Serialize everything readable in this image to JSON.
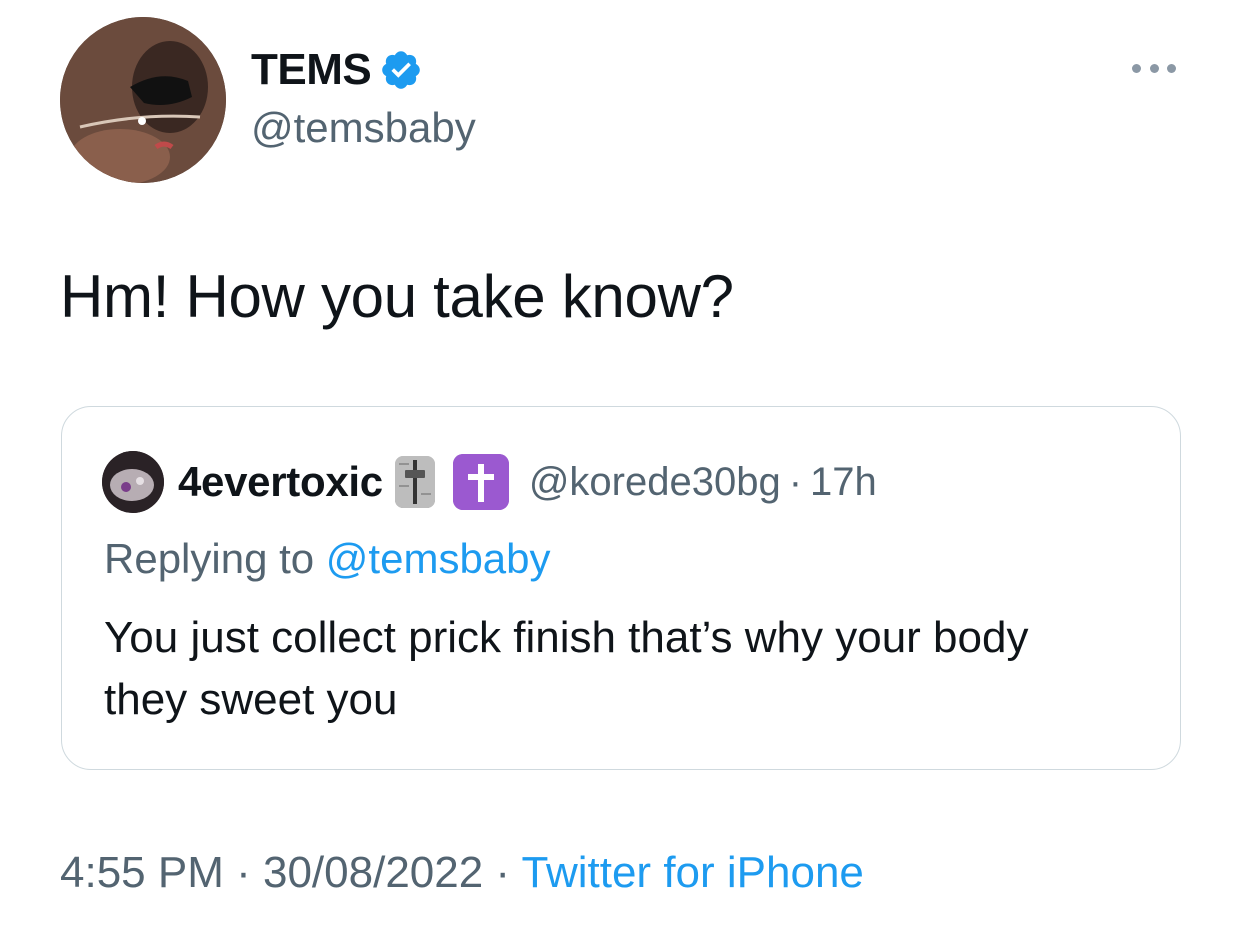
{
  "tweet": {
    "author": {
      "display_name": "TEMS",
      "handle": "@temsbaby",
      "verified_icon": "verified-badge-icon",
      "avatar_icon": "profile-photo"
    },
    "more_icon": "more-options-icon",
    "text": "Hm! How you take know?",
    "quoted": {
      "display_name": "4evertoxic",
      "emojis": [
        "level-slider-emoji",
        "latin-cross-emoji"
      ],
      "handle": "@korede30bg",
      "separator": "·",
      "time": "17h",
      "replying_prefix": "Replying to ",
      "replying_to": "@temsbaby",
      "text": "You just collect prick finish that’s why your body they sweet you"
    },
    "meta": {
      "time": "4:55 PM",
      "separator": " · ",
      "date": "30/08/2022",
      "source": "Twitter for iPhone"
    }
  },
  "colors": {
    "text_primary": "#0f1419",
    "text_secondary": "#536471",
    "link": "#1d9bf0",
    "border": "#cfd9de"
  }
}
